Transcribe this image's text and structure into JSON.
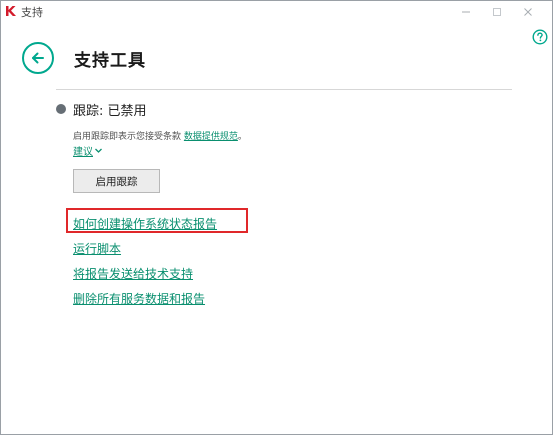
{
  "window": {
    "title": "支持",
    "controls": [
      "minimize",
      "maximize",
      "close"
    ]
  },
  "icons": {
    "app_logo": "kaspersky-k-logo",
    "help": "help-icon",
    "back": "back-arrow-icon",
    "status": "status-dot",
    "chevron": "chevron-down-icon"
  },
  "colors": {
    "accent": "#00a88e",
    "link": "#0a8f6f",
    "status_dot": "#666e75",
    "highlight": "#e0282a"
  },
  "header": {
    "title": "支持工具"
  },
  "tracing": {
    "status_text": "跟踪: 已禁用",
    "consent_prefix": "启用跟踪即表示您接受条款",
    "consent_link": "数据提供规范",
    "consent_suffix": "。",
    "suggest_label": "建议",
    "enable_button": "启用跟踪"
  },
  "links": [
    "如何创建操作系统状态报告",
    "运行脚本",
    "将报告发送给技术支持",
    "删除所有服务数据和报告"
  ]
}
